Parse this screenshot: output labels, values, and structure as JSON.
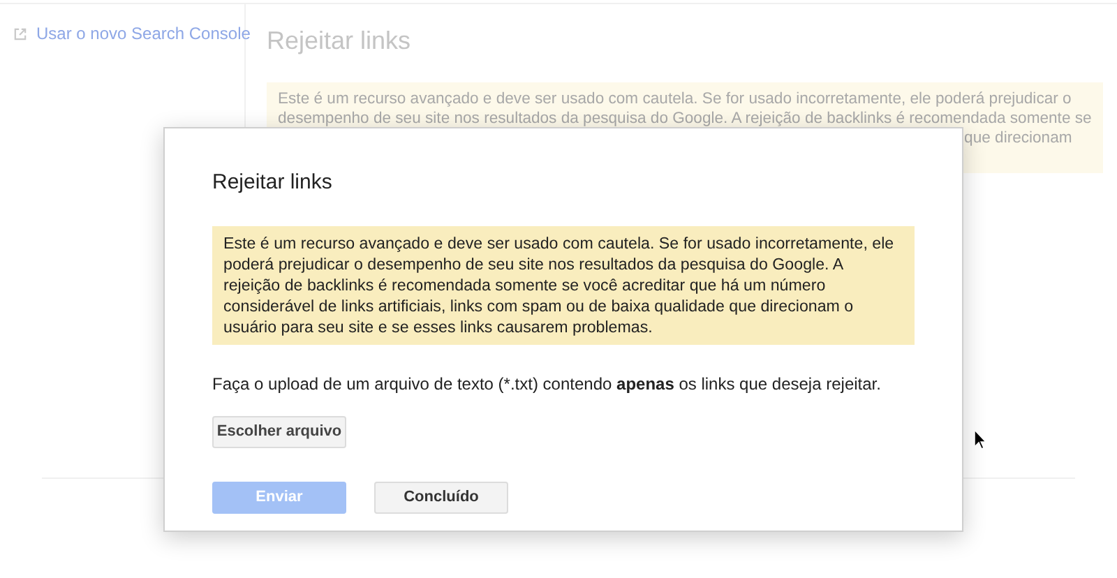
{
  "sidebar": {
    "link": "Usar o novo Search Console"
  },
  "page": {
    "title": "Rejeitar links",
    "warning_lines": [
      "Este é um recurso avançado e deve ser usado com cautela. Se for usado incorretamente, ele poderá prejudicar o",
      "desempenho de seu site nos resultados da pesquisa do Google. A rejeição de backlinks é recomendada somente se"
    ],
    "warning_fragment": "que direcionam"
  },
  "dialog": {
    "title": "Rejeitar links",
    "warning": "Este é um recurso avançado e deve ser usado com cautela. Se for usado incorretamente, ele poderá prejudicar o desempenho de seu site nos resultados da pesquisa do Google. A rejeição de backlinks é recomendada somente se você acreditar que há um número considerável de links artificiais, links com spam ou de baixa qualidade que direcionam o usuário para seu site e se esses links causarem problemas.",
    "instruction": "Faça o upload de um arquivo de texto (*.txt) contendo **apenas** os links que deseja rejeitar.",
    "file_button": "Escolher arquivo",
    "buttons": [
      {
        "label": "Enviar",
        "kind": "primary",
        "disabled": true
      },
      {
        "label": "Concluído",
        "kind": "secondary",
        "disabled": false
      }
    ]
  }
}
